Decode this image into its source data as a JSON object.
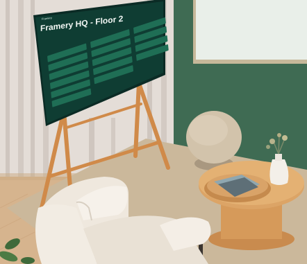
{
  "scene": {
    "description_free": true
  },
  "screen": {
    "venue": "Framery",
    "title": "Framery HQ - Floor 2"
  },
  "colors": {
    "wall_green": "#3f6b53",
    "curtain": "#e6ded8",
    "floor": "#d9b58d",
    "rug": "#cdbb9f",
    "screen_bg": "#0f3d33",
    "tile": "#1e6b52",
    "wood": "#d08a49",
    "chair": "#f1ebe2",
    "pouf": "#d2c3ab"
  }
}
